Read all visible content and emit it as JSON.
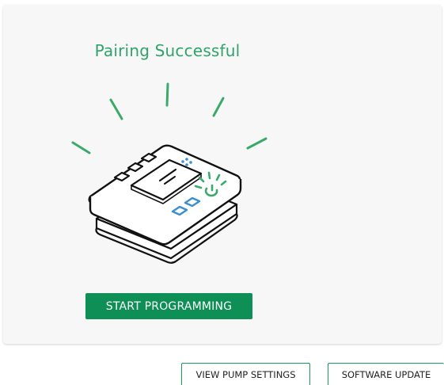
{
  "card": {
    "title": "Pairing Successful",
    "illustration_icon": "pump-device-icon",
    "primary_button_label": "START PROGRAMMING"
  },
  "actions": {
    "view_pump_settings_label": "VIEW PUMP SETTINGS",
    "software_update_label": "SOFTWARE UPDATE"
  },
  "colors": {
    "accent_green": "#0e8f55",
    "title_green": "#2fa36b",
    "ray_green": "#3aaa6a",
    "button_blue": "#3b8fd0"
  }
}
